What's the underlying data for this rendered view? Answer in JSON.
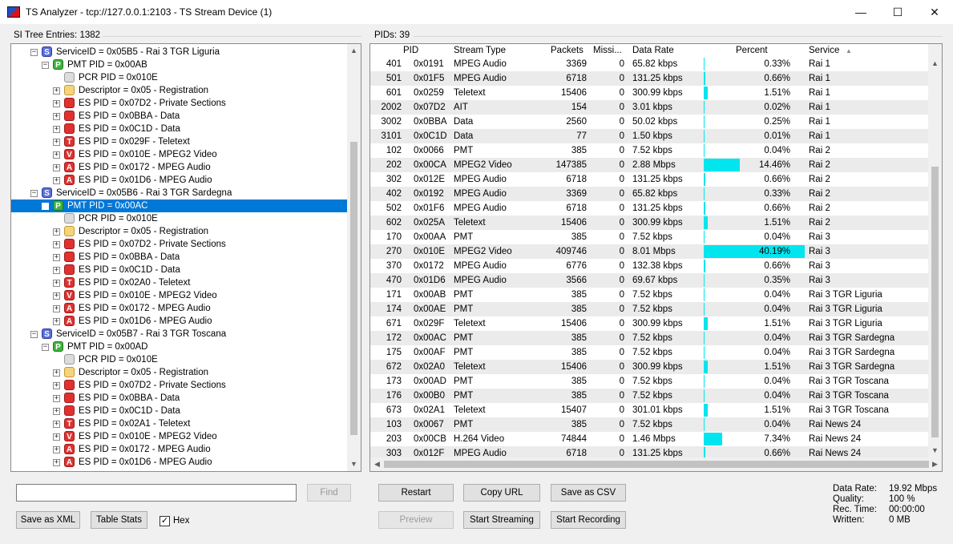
{
  "window": {
    "title": "TS Analyzer - tcp://127.0.0.1:2103 - TS Stream Device (1)",
    "minimize": "—",
    "maximize": "☐",
    "close": "✕"
  },
  "si_tree": {
    "label": "SI Tree Entries: 1382",
    "rows": [
      {
        "depth": 1,
        "exp": "−",
        "icon": "svc",
        "letter": "S",
        "text": "ServiceID = 0x05B5 - Rai 3 TGR Liguria"
      },
      {
        "depth": 2,
        "exp": "−",
        "icon": "pmt",
        "letter": "P",
        "text": "PMT PID = 0x00AB"
      },
      {
        "depth": 3,
        "exp": "",
        "icon": "pcr",
        "letter": "",
        "text": "PCR PID = 0x010E"
      },
      {
        "depth": 3,
        "exp": "+",
        "icon": "desc",
        "letter": "",
        "text": "Descriptor = 0x05 - Registration"
      },
      {
        "depth": 3,
        "exp": "+",
        "icon": "es",
        "letter": "",
        "text": "ES PID = 0x07D2 - Private Sections"
      },
      {
        "depth": 3,
        "exp": "+",
        "icon": "es",
        "letter": "",
        "text": "ES PID = 0x0BBA - Data"
      },
      {
        "depth": 3,
        "exp": "+",
        "icon": "es",
        "letter": "",
        "text": "ES PID = 0x0C1D - Data"
      },
      {
        "depth": 3,
        "exp": "+",
        "icon": "es",
        "letter": "T",
        "text": "ES PID = 0x029F - Teletext"
      },
      {
        "depth": 3,
        "exp": "+",
        "icon": "es",
        "letter": "V",
        "text": "ES PID = 0x010E - MPEG2 Video"
      },
      {
        "depth": 3,
        "exp": "+",
        "icon": "es",
        "letter": "A",
        "text": "ES PID = 0x0172 - MPEG Audio"
      },
      {
        "depth": 3,
        "exp": "+",
        "icon": "es",
        "letter": "A",
        "text": "ES PID = 0x01D6 - MPEG Audio"
      },
      {
        "depth": 1,
        "exp": "−",
        "icon": "svc",
        "letter": "S",
        "text": "ServiceID = 0x05B6 - Rai 3 TGR Sardegna"
      },
      {
        "depth": 2,
        "exp": "−",
        "icon": "pmt",
        "letter": "P",
        "text": "PMT PID = 0x00AC",
        "selected": true
      },
      {
        "depth": 3,
        "exp": "",
        "icon": "pcr",
        "letter": "",
        "text": "PCR PID = 0x010E"
      },
      {
        "depth": 3,
        "exp": "+",
        "icon": "desc",
        "letter": "",
        "text": "Descriptor = 0x05 - Registration"
      },
      {
        "depth": 3,
        "exp": "+",
        "icon": "es",
        "letter": "",
        "text": "ES PID = 0x07D2 - Private Sections"
      },
      {
        "depth": 3,
        "exp": "+",
        "icon": "es",
        "letter": "",
        "text": "ES PID = 0x0BBA - Data"
      },
      {
        "depth": 3,
        "exp": "+",
        "icon": "es",
        "letter": "",
        "text": "ES PID = 0x0C1D - Data"
      },
      {
        "depth": 3,
        "exp": "+",
        "icon": "es",
        "letter": "T",
        "text": "ES PID = 0x02A0 - Teletext"
      },
      {
        "depth": 3,
        "exp": "+",
        "icon": "es",
        "letter": "V",
        "text": "ES PID = 0x010E - MPEG2 Video"
      },
      {
        "depth": 3,
        "exp": "+",
        "icon": "es",
        "letter": "A",
        "text": "ES PID = 0x0172 - MPEG Audio"
      },
      {
        "depth": 3,
        "exp": "+",
        "icon": "es",
        "letter": "A",
        "text": "ES PID = 0x01D6 - MPEG Audio"
      },
      {
        "depth": 1,
        "exp": "−",
        "icon": "svc",
        "letter": "S",
        "text": "ServiceID = 0x05B7 - Rai 3 TGR Toscana"
      },
      {
        "depth": 2,
        "exp": "−",
        "icon": "pmt",
        "letter": "P",
        "text": "PMT PID = 0x00AD"
      },
      {
        "depth": 3,
        "exp": "",
        "icon": "pcr",
        "letter": "",
        "text": "PCR PID = 0x010E"
      },
      {
        "depth": 3,
        "exp": "+",
        "icon": "desc",
        "letter": "",
        "text": "Descriptor = 0x05 - Registration"
      },
      {
        "depth": 3,
        "exp": "+",
        "icon": "es",
        "letter": "",
        "text": "ES PID = 0x07D2 - Private Sections"
      },
      {
        "depth": 3,
        "exp": "+",
        "icon": "es",
        "letter": "",
        "text": "ES PID = 0x0BBA - Data"
      },
      {
        "depth": 3,
        "exp": "+",
        "icon": "es",
        "letter": "",
        "text": "ES PID = 0x0C1D - Data"
      },
      {
        "depth": 3,
        "exp": "+",
        "icon": "es",
        "letter": "T",
        "text": "ES PID = 0x02A1 - Teletext"
      },
      {
        "depth": 3,
        "exp": "+",
        "icon": "es",
        "letter": "V",
        "text": "ES PID = 0x010E - MPEG2 Video"
      },
      {
        "depth": 3,
        "exp": "+",
        "icon": "es",
        "letter": "A",
        "text": "ES PID = 0x0172 - MPEG Audio"
      },
      {
        "depth": 3,
        "exp": "+",
        "icon": "es",
        "letter": "A",
        "text": "ES PID = 0x01D6 - MPEG Audio"
      }
    ]
  },
  "pids": {
    "label": "PIDs: 39",
    "columns": {
      "pid": "PID",
      "stream_type": "Stream Type",
      "packets": "Packets",
      "missing": "Missi...",
      "data_rate": "Data Rate",
      "percent": "Percent",
      "service": "Service",
      "sort_arrow": "▲"
    },
    "rows": [
      {
        "dec": "401",
        "hex": "0x0191",
        "type": "MPEG Audio",
        "packets": "3369",
        "missing": "0",
        "rate": "65.82 kbps",
        "percent": "0.33%",
        "pct": 0.33,
        "service": "Rai 1"
      },
      {
        "dec": "501",
        "hex": "0x01F5",
        "type": "MPEG Audio",
        "packets": "6718",
        "missing": "0",
        "rate": "131.25 kbps",
        "percent": "0.66%",
        "pct": 0.66,
        "service": "Rai 1"
      },
      {
        "dec": "601",
        "hex": "0x0259",
        "type": "Teletext",
        "packets": "15406",
        "missing": "0",
        "rate": "300.99 kbps",
        "percent": "1.51%",
        "pct": 1.51,
        "service": "Rai 1"
      },
      {
        "dec": "2002",
        "hex": "0x07D2",
        "type": "AIT",
        "packets": "154",
        "missing": "0",
        "rate": "3.01 kbps",
        "percent": "0.02%",
        "pct": 0.02,
        "service": "Rai 1"
      },
      {
        "dec": "3002",
        "hex": "0x0BBA",
        "type": "Data",
        "packets": "2560",
        "missing": "0",
        "rate": "50.02 kbps",
        "percent": "0.25%",
        "pct": 0.25,
        "service": "Rai 1"
      },
      {
        "dec": "3101",
        "hex": "0x0C1D",
        "type": "Data",
        "packets": "77",
        "missing": "0",
        "rate": "1.50 kbps",
        "percent": "0.01%",
        "pct": 0.01,
        "service": "Rai 1"
      },
      {
        "dec": "102",
        "hex": "0x0066",
        "type": "PMT",
        "packets": "385",
        "missing": "0",
        "rate": "7.52 kbps",
        "percent": "0.04%",
        "pct": 0.04,
        "service": "Rai 2"
      },
      {
        "dec": "202",
        "hex": "0x00CA",
        "type": "MPEG2 Video",
        "packets": "147385",
        "missing": "0",
        "rate": "2.88 Mbps",
        "percent": "14.46%",
        "pct": 14.46,
        "service": "Rai 2"
      },
      {
        "dec": "302",
        "hex": "0x012E",
        "type": "MPEG Audio",
        "packets": "6718",
        "missing": "0",
        "rate": "131.25 kbps",
        "percent": "0.66%",
        "pct": 0.66,
        "service": "Rai 2"
      },
      {
        "dec": "402",
        "hex": "0x0192",
        "type": "MPEG Audio",
        "packets": "3369",
        "missing": "0",
        "rate": "65.82 kbps",
        "percent": "0.33%",
        "pct": 0.33,
        "service": "Rai 2"
      },
      {
        "dec": "502",
        "hex": "0x01F6",
        "type": "MPEG Audio",
        "packets": "6718",
        "missing": "0",
        "rate": "131.25 kbps",
        "percent": "0.66%",
        "pct": 0.66,
        "service": "Rai 2"
      },
      {
        "dec": "602",
        "hex": "0x025A",
        "type": "Teletext",
        "packets": "15406",
        "missing": "0",
        "rate": "300.99 kbps",
        "percent": "1.51%",
        "pct": 1.51,
        "service": "Rai 2"
      },
      {
        "dec": "170",
        "hex": "0x00AA",
        "type": "PMT",
        "packets": "385",
        "missing": "0",
        "rate": "7.52 kbps",
        "percent": "0.04%",
        "pct": 0.04,
        "service": "Rai 3"
      },
      {
        "dec": "270",
        "hex": "0x010E",
        "type": "MPEG2 Video",
        "packets": "409746",
        "missing": "0",
        "rate": "8.01 Mbps",
        "percent": "40.19%",
        "pct": 40.19,
        "service": "Rai 3"
      },
      {
        "dec": "370",
        "hex": "0x0172",
        "type": "MPEG Audio",
        "packets": "6776",
        "missing": "0",
        "rate": "132.38 kbps",
        "percent": "0.66%",
        "pct": 0.66,
        "service": "Rai 3"
      },
      {
        "dec": "470",
        "hex": "0x01D6",
        "type": "MPEG Audio",
        "packets": "3566",
        "missing": "0",
        "rate": "69.67 kbps",
        "percent": "0.35%",
        "pct": 0.35,
        "service": "Rai 3"
      },
      {
        "dec": "171",
        "hex": "0x00AB",
        "type": "PMT",
        "packets": "385",
        "missing": "0",
        "rate": "7.52 kbps",
        "percent": "0.04%",
        "pct": 0.04,
        "service": "Rai 3 TGR Liguria"
      },
      {
        "dec": "174",
        "hex": "0x00AE",
        "type": "PMT",
        "packets": "385",
        "missing": "0",
        "rate": "7.52 kbps",
        "percent": "0.04%",
        "pct": 0.04,
        "service": "Rai 3 TGR Liguria"
      },
      {
        "dec": "671",
        "hex": "0x029F",
        "type": "Teletext",
        "packets": "15406",
        "missing": "0",
        "rate": "300.99 kbps",
        "percent": "1.51%",
        "pct": 1.51,
        "service": "Rai 3 TGR Liguria"
      },
      {
        "dec": "172",
        "hex": "0x00AC",
        "type": "PMT",
        "packets": "385",
        "missing": "0",
        "rate": "7.52 kbps",
        "percent": "0.04%",
        "pct": 0.04,
        "service": "Rai 3 TGR Sardegna"
      },
      {
        "dec": "175",
        "hex": "0x00AF",
        "type": "PMT",
        "packets": "385",
        "missing": "0",
        "rate": "7.52 kbps",
        "percent": "0.04%",
        "pct": 0.04,
        "service": "Rai 3 TGR Sardegna"
      },
      {
        "dec": "672",
        "hex": "0x02A0",
        "type": "Teletext",
        "packets": "15406",
        "missing": "0",
        "rate": "300.99 kbps",
        "percent": "1.51%",
        "pct": 1.51,
        "service": "Rai 3 TGR Sardegna"
      },
      {
        "dec": "173",
        "hex": "0x00AD",
        "type": "PMT",
        "packets": "385",
        "missing": "0",
        "rate": "7.52 kbps",
        "percent": "0.04%",
        "pct": 0.04,
        "service": "Rai 3 TGR Toscana"
      },
      {
        "dec": "176",
        "hex": "0x00B0",
        "type": "PMT",
        "packets": "385",
        "missing": "0",
        "rate": "7.52 kbps",
        "percent": "0.04%",
        "pct": 0.04,
        "service": "Rai 3 TGR Toscana"
      },
      {
        "dec": "673",
        "hex": "0x02A1",
        "type": "Teletext",
        "packets": "15407",
        "missing": "0",
        "rate": "301.01 kbps",
        "percent": "1.51%",
        "pct": 1.51,
        "service": "Rai 3 TGR Toscana"
      },
      {
        "dec": "103",
        "hex": "0x0067",
        "type": "PMT",
        "packets": "385",
        "missing": "0",
        "rate": "7.52 kbps",
        "percent": "0.04%",
        "pct": 0.04,
        "service": "Rai News 24"
      },
      {
        "dec": "203",
        "hex": "0x00CB",
        "type": "H.264 Video",
        "packets": "74844",
        "missing": "0",
        "rate": "1.46 Mbps",
        "percent": "7.34%",
        "pct": 7.34,
        "service": "Rai News 24"
      },
      {
        "dec": "303",
        "hex": "0x012F",
        "type": "MPEG Audio",
        "packets": "6718",
        "missing": "0",
        "rate": "131.25 kbps",
        "percent": "0.66%",
        "pct": 0.66,
        "service": "Rai News 24"
      }
    ],
    "bar_color": "#00e5ee"
  },
  "controls": {
    "find_value": "",
    "find": "Find",
    "save_xml": "Save as XML",
    "table_stats": "Table Stats",
    "hex_label": "Hex",
    "hex_checked": "✓",
    "restart": "Restart",
    "copy_url": "Copy URL",
    "save_csv": "Save as CSV",
    "preview": "Preview",
    "start_streaming": "Start Streaming",
    "start_recording": "Start Recording"
  },
  "stats": {
    "data_rate_label": "Data Rate:",
    "data_rate": "19.92 Mbps",
    "quality_label": "Quality:",
    "quality": "100 %",
    "rec_time_label": "Rec. Time:",
    "rec_time": "00:00:00",
    "written_label": "Written:",
    "written": "0 MB"
  },
  "scroll": {
    "up": "▲",
    "down": "▼",
    "left": "◀",
    "right": "▶"
  }
}
